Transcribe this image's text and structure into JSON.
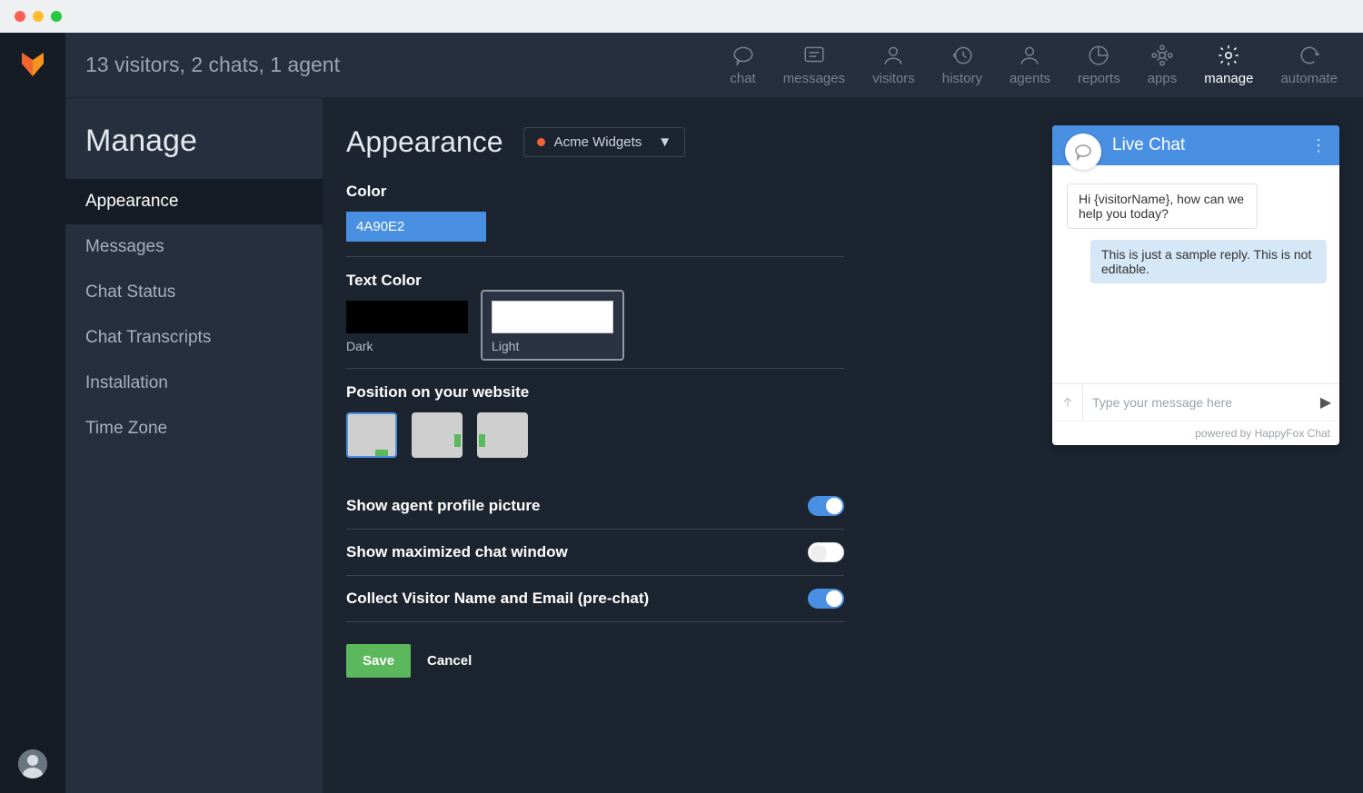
{
  "titlebar": {
    "dots": [
      "red",
      "yellow",
      "green"
    ]
  },
  "header": {
    "status": "13 visitors, 2 chats, 1 agent",
    "nav": [
      {
        "label": "chat",
        "icon": "chat"
      },
      {
        "label": "messages",
        "icon": "messages"
      },
      {
        "label": "visitors",
        "icon": "visitors"
      },
      {
        "label": "history",
        "icon": "history"
      },
      {
        "label": "agents",
        "icon": "agents"
      },
      {
        "label": "reports",
        "icon": "reports"
      },
      {
        "label": "apps",
        "icon": "apps"
      },
      {
        "label": "manage",
        "icon": "manage",
        "active": true
      },
      {
        "label": "automate",
        "icon": "automate"
      }
    ]
  },
  "sidebar": {
    "title": "Manage",
    "items": [
      {
        "label": "Appearance",
        "active": true
      },
      {
        "label": "Messages"
      },
      {
        "label": "Chat Status"
      },
      {
        "label": "Chat Transcripts"
      },
      {
        "label": "Installation"
      },
      {
        "label": "Time Zone"
      }
    ]
  },
  "page": {
    "title": "Appearance",
    "profile_dropdown": "Acme Widgets",
    "color": {
      "label": "Color",
      "value": "4A90E2",
      "hex": "#4A90E2"
    },
    "text_color": {
      "label": "Text Color",
      "options": [
        {
          "label": "Dark",
          "selected": false
        },
        {
          "label": "Light",
          "selected": true
        }
      ]
    },
    "position": {
      "label": "Position on your website",
      "selected": 0
    },
    "toggles": [
      {
        "label": "Show agent profile picture",
        "on": true
      },
      {
        "label": "Show maximized chat window",
        "on": false
      },
      {
        "label": "Collect Visitor Name and Email (pre-chat)",
        "on": true
      }
    ],
    "save_label": "Save",
    "cancel_label": "Cancel"
  },
  "chat_preview": {
    "title": "Live Chat",
    "bubble_in": "Hi {visitorName}, how can we help you today?",
    "bubble_out": "This is just a sample reply. This is not editable.",
    "input_placeholder": "Type your message here",
    "powered": "powered by HappyFox Chat"
  }
}
